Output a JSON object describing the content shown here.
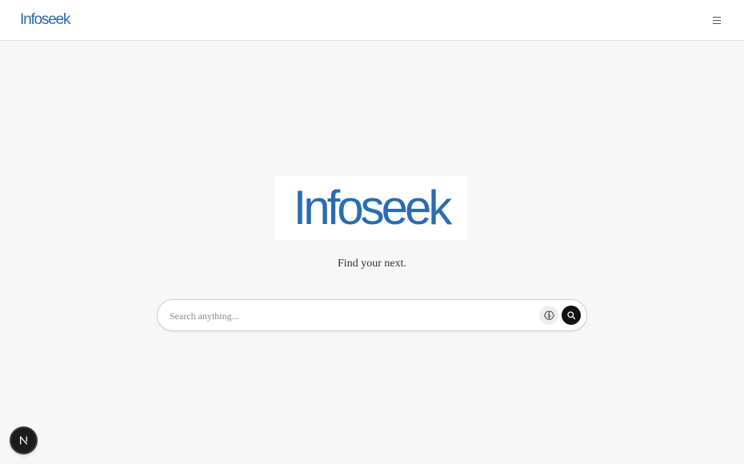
{
  "header": {
    "logo_text": "Infoseek",
    "menu_icon": "hamburger-menu-icon"
  },
  "hero": {
    "logo_text": "Infoseek",
    "tagline": "Find your next."
  },
  "search": {
    "placeholder": "Search anything...",
    "value": "",
    "ai_icon": "ai-brain-icon",
    "submit_icon": "search-icon"
  },
  "dev_badge": {
    "label": "N"
  },
  "colors": {
    "brand": "#2a6cb0",
    "page_background": "#f7f7f7",
    "search_button": "#111111"
  }
}
